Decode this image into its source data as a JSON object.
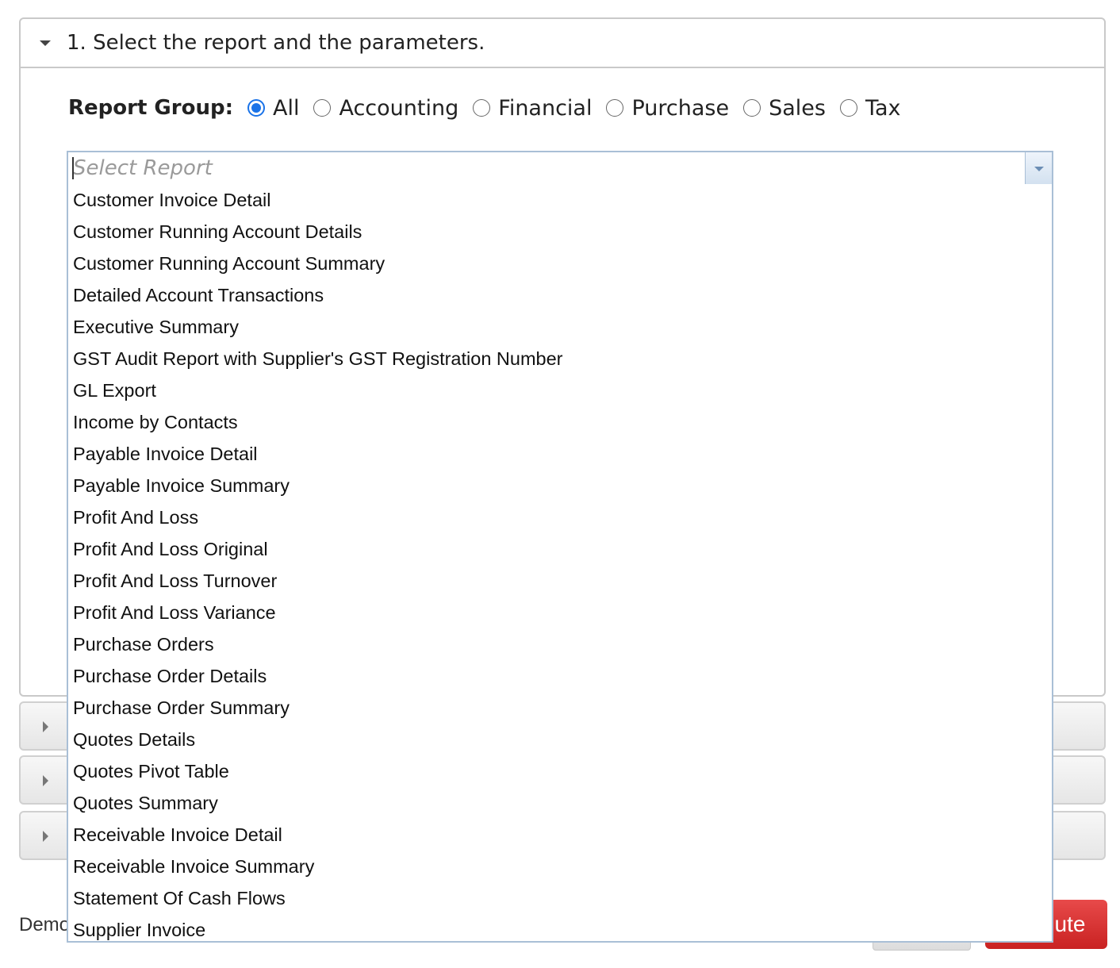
{
  "section1": {
    "title": "1. Select the report and the parameters."
  },
  "report_group": {
    "label": "Report Group:",
    "options": [
      {
        "label": "All",
        "checked": true
      },
      {
        "label": "Accounting",
        "checked": false
      },
      {
        "label": "Financial",
        "checked": false
      },
      {
        "label": "Purchase",
        "checked": false
      },
      {
        "label": "Sales",
        "checked": false
      },
      {
        "label": "Tax",
        "checked": false
      }
    ]
  },
  "report_select": {
    "placeholder": "Select Report",
    "value": ""
  },
  "dropdown": {
    "items": [
      "Customer Invoice Detail",
      "Customer Running Account Details",
      "Customer Running Account Summary",
      "Detailed Account Transactions",
      "Executive Summary",
      "GST Audit Report with Supplier's GST Registration Number",
      "GL Export",
      "Income by Contacts",
      "Payable Invoice Detail",
      "Payable Invoice Summary",
      "Profit And Loss",
      "Profit And Loss Original",
      "Profit And Loss Turnover",
      "Profit And Loss Variance",
      "Purchase Orders",
      "Purchase Order Details",
      "Purchase Order Summary",
      "Quotes Details",
      "Quotes Pivot Table",
      "Quotes Summary",
      "Receivable Invoice Detail",
      "Receivable Invoice Summary",
      "Statement Of Cash Flows",
      "Supplier Invoice"
    ]
  },
  "footer": {
    "left_text": "Demo",
    "execute_label": "ute"
  },
  "colors": {
    "accent": "#1a73e8",
    "execute": "#d32f2f",
    "combo_border": "#a9bfd6"
  }
}
